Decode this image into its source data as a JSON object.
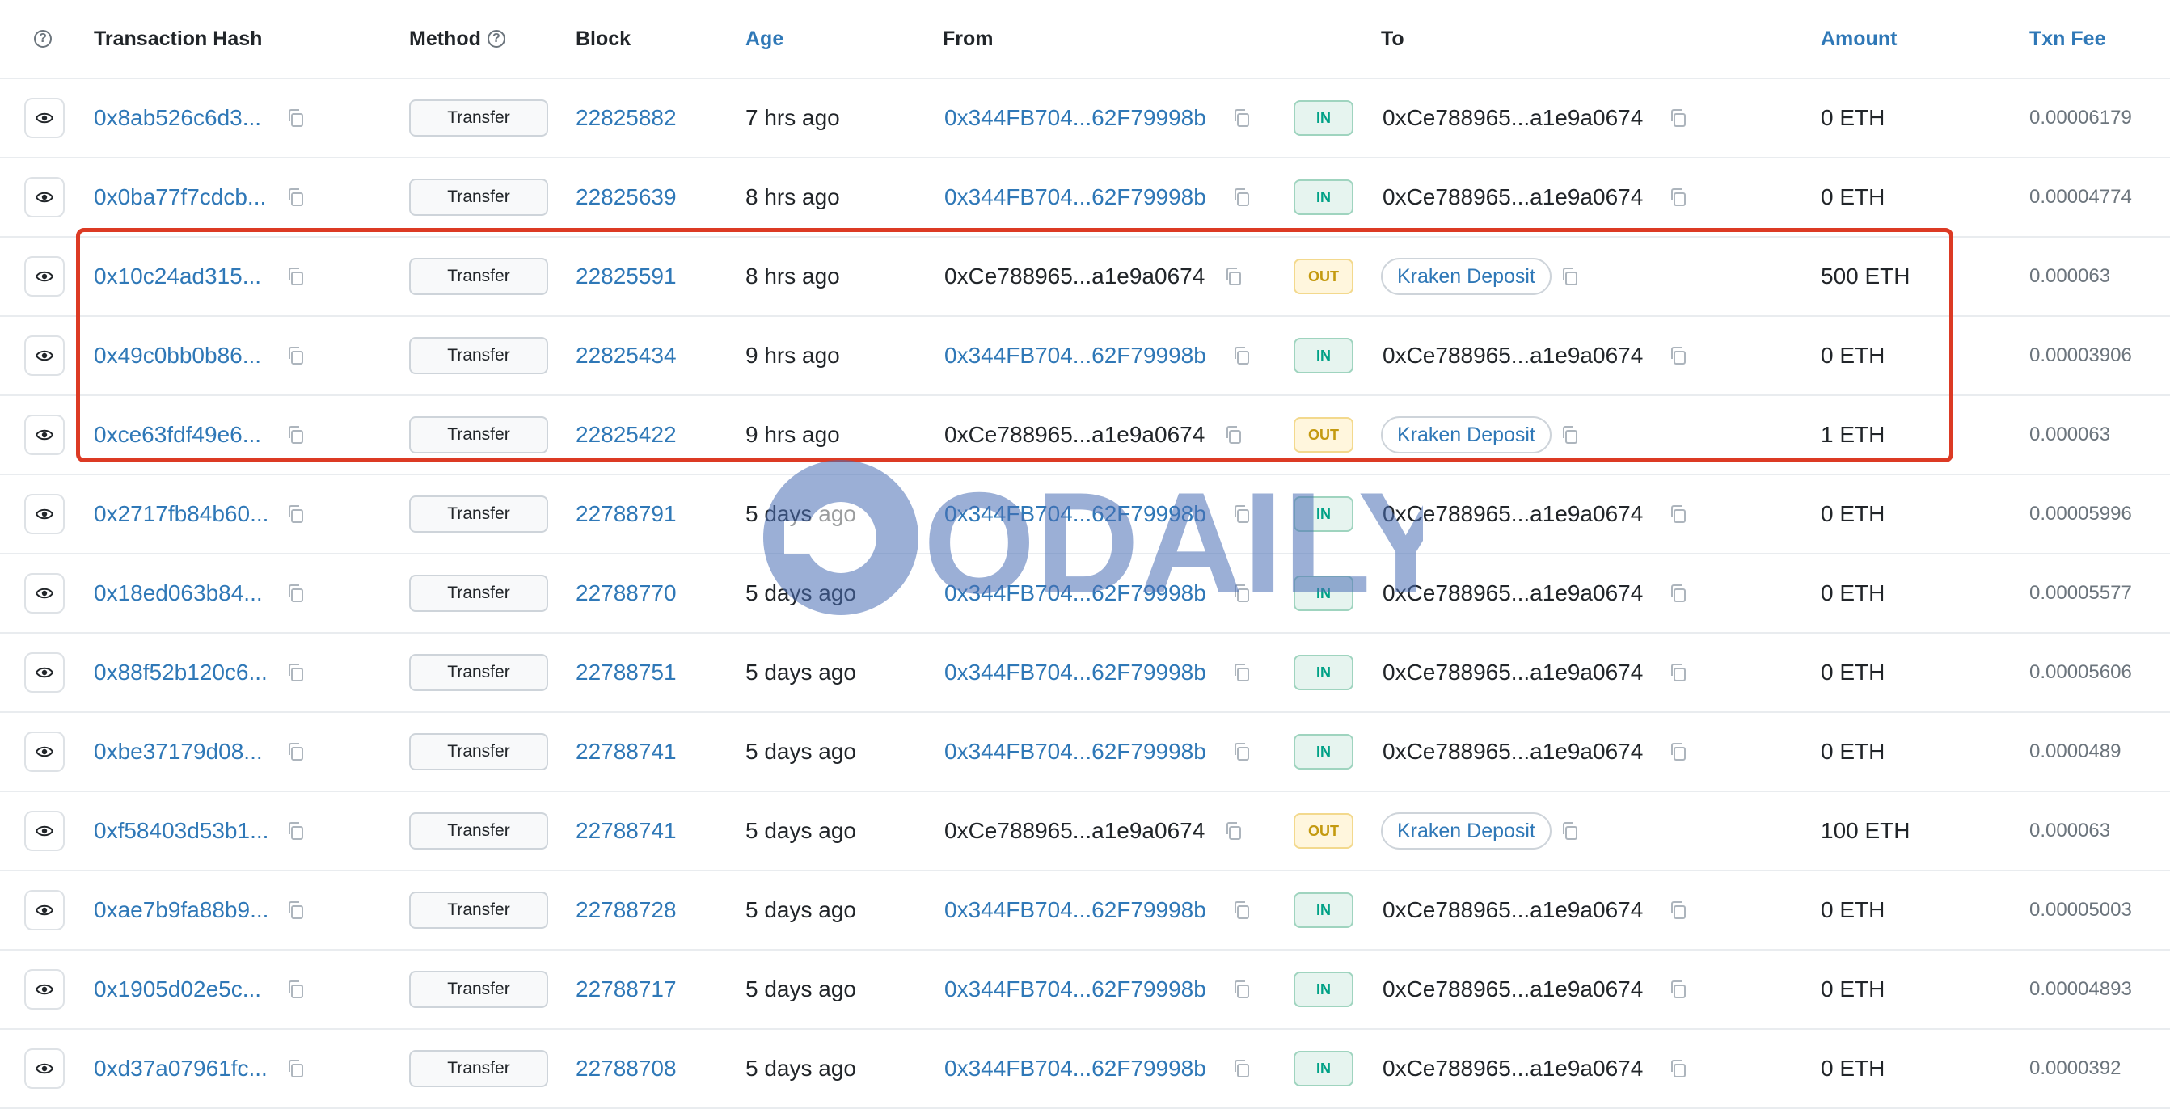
{
  "header": {
    "tx_hash": "Transaction Hash",
    "method": "Method",
    "block": "Block",
    "age": "Age",
    "from": "From",
    "to": "To",
    "amount": "Amount",
    "txn_fee": "Txn Fee"
  },
  "icons": {
    "help": "question-circle-icon",
    "view": "eye-icon",
    "copy": "copy-icon"
  },
  "colors": {
    "link": "#2f78b7",
    "in": "#00a186",
    "out": "#c49a10",
    "highlight": "#dc3a24",
    "watermark": "#4a6fb5"
  },
  "watermark": "ODAILY",
  "rows": [
    {
      "hash": "0x8ab526c6d3...",
      "method": "Transfer",
      "block": "22825882",
      "age": "7 hrs ago",
      "from": "0x344FB704...62F79998b",
      "dir": "IN",
      "to": "0xCe788965...a1e9a0674",
      "amount": "0 ETH",
      "fee": "0.00006179"
    },
    {
      "hash": "0x0ba77f7cdcb...",
      "method": "Transfer",
      "block": "22825639",
      "age": "8 hrs ago",
      "from": "0x344FB704...62F79998b",
      "dir": "IN",
      "to": "0xCe788965...a1e9a0674",
      "amount": "0 ETH",
      "fee": "0.00004774"
    },
    {
      "hash": "0x10c24ad315...",
      "method": "Transfer",
      "block": "22825591",
      "age": "8 hrs ago",
      "from": "0xCe788965...a1e9a0674",
      "dir": "OUT",
      "to": "Kraken Deposit",
      "amount": "500 ETH",
      "fee": "0.000063"
    },
    {
      "hash": "0x49c0bb0b86...",
      "method": "Transfer",
      "block": "22825434",
      "age": "9 hrs ago",
      "from": "0x344FB704...62F79998b",
      "dir": "IN",
      "to": "0xCe788965...a1e9a0674",
      "amount": "0 ETH",
      "fee": "0.00003906"
    },
    {
      "hash": "0xce63fdf49e6...",
      "method": "Transfer",
      "block": "22825422",
      "age": "9 hrs ago",
      "from": "0xCe788965...a1e9a0674",
      "dir": "OUT",
      "to": "Kraken Deposit",
      "amount": "1 ETH",
      "fee": "0.000063"
    },
    {
      "hash": "0x2717fb84b60...",
      "method": "Transfer",
      "block": "22788791",
      "age": "5 days ago",
      "from": "0x344FB704...62F79998b",
      "dir": "IN",
      "to": "0xCe788965...a1e9a0674",
      "amount": "0 ETH",
      "fee": "0.00005996"
    },
    {
      "hash": "0x18ed063b84...",
      "method": "Transfer",
      "block": "22788770",
      "age": "5 days ago",
      "from": "0x344FB704...62F79998b",
      "dir": "IN",
      "to": "0xCe788965...a1e9a0674",
      "amount": "0 ETH",
      "fee": "0.00005577"
    },
    {
      "hash": "0x88f52b120c6...",
      "method": "Transfer",
      "block": "22788751",
      "age": "5 days ago",
      "from": "0x344FB704...62F79998b",
      "dir": "IN",
      "to": "0xCe788965...a1e9a0674",
      "amount": "0 ETH",
      "fee": "0.00005606"
    },
    {
      "hash": "0xbe37179d08...",
      "method": "Transfer",
      "block": "22788741",
      "age": "5 days ago",
      "from": "0x344FB704...62F79998b",
      "dir": "IN",
      "to": "0xCe788965...a1e9a0674",
      "amount": "0 ETH",
      "fee": "0.0000489"
    },
    {
      "hash": "0xf58403d53b1...",
      "method": "Transfer",
      "block": "22788741",
      "age": "5 days ago",
      "from": "0xCe788965...a1e9a0674",
      "dir": "OUT",
      "to": "Kraken Deposit",
      "amount": "100 ETH",
      "fee": "0.000063"
    },
    {
      "hash": "0xae7b9fa88b9...",
      "method": "Transfer",
      "block": "22788728",
      "age": "5 days ago",
      "from": "0x344FB704...62F79998b",
      "dir": "IN",
      "to": "0xCe788965...a1e9a0674",
      "amount": "0 ETH",
      "fee": "0.00005003"
    },
    {
      "hash": "0x1905d02e5c...",
      "method": "Transfer",
      "block": "22788717",
      "age": "5 days ago",
      "from": "0x344FB704...62F79998b",
      "dir": "IN",
      "to": "0xCe788965...a1e9a0674",
      "amount": "0 ETH",
      "fee": "0.00004893"
    },
    {
      "hash": "0xd37a07961fc...",
      "method": "Transfer",
      "block": "22788708",
      "age": "5 days ago",
      "from": "0x344FB704...62F79998b",
      "dir": "IN",
      "to": "0xCe788965...a1e9a0674",
      "amount": "0 ETH",
      "fee": "0.0000392"
    }
  ]
}
